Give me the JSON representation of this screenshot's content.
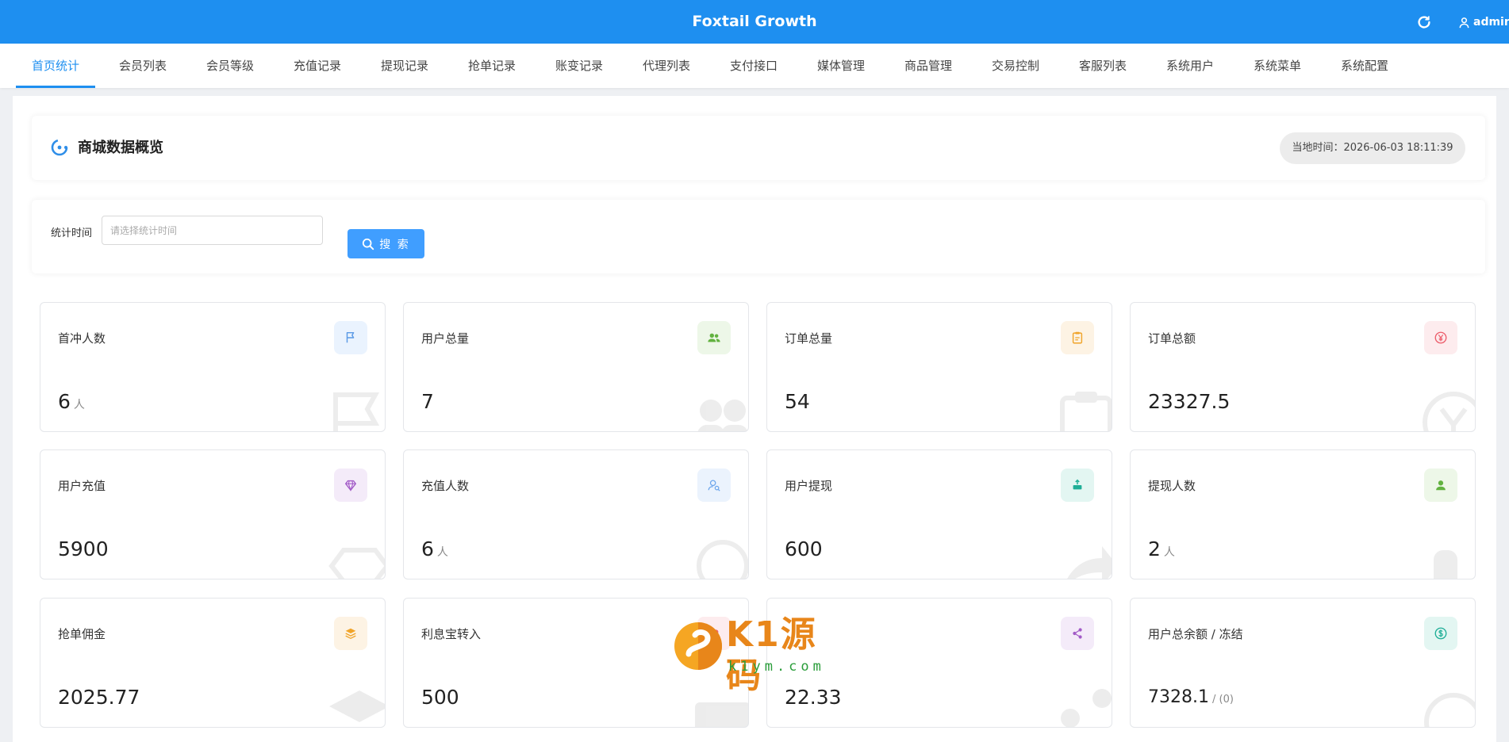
{
  "header": {
    "title": "Foxtail Growth",
    "user": "admin"
  },
  "nav": {
    "items": [
      {
        "label": "首页统计",
        "active": true
      },
      {
        "label": "会员列表"
      },
      {
        "label": "会员等级"
      },
      {
        "label": "充值记录"
      },
      {
        "label": "提现记录"
      },
      {
        "label": "抢单记录"
      },
      {
        "label": "账变记录"
      },
      {
        "label": "代理列表"
      },
      {
        "label": "支付接口"
      },
      {
        "label": "媒体管理"
      },
      {
        "label": "商品管理"
      },
      {
        "label": "交易控制"
      },
      {
        "label": "客服列表"
      },
      {
        "label": "系统用户"
      },
      {
        "label": "系统菜单"
      },
      {
        "label": "系统配置"
      }
    ]
  },
  "overview": {
    "title": "商城数据概览",
    "time_label": "当地时间：",
    "time_value": "2026-06-03 18:11:39"
  },
  "filter": {
    "label": "统计时间",
    "placeholder": "请选择统计时间",
    "search_label": "搜 索"
  },
  "cards": [
    {
      "label": "首冲人数",
      "value": "6",
      "unit": "人",
      "icon": "flag-icon",
      "color": "#5b9ae6",
      "bg": "#eaf3fe"
    },
    {
      "label": "用户总量",
      "value": "7",
      "icon": "users-icon",
      "color": "#62b240",
      "bg": "#edf7e8"
    },
    {
      "label": "订单总量",
      "value": "54",
      "icon": "clipboard-icon",
      "color": "#f0a42a",
      "bg": "#fdf3e4"
    },
    {
      "label": "订单总额",
      "value": "23327.5",
      "icon": "yen-icon",
      "color": "#ec5d6b",
      "bg": "#fdecee"
    },
    {
      "label": "用户充值",
      "value": "5900",
      "icon": "diamond-icon",
      "color": "#a25bc7",
      "bg": "#f4ebf9"
    },
    {
      "label": "充值人数",
      "value": "6",
      "unit": "人",
      "icon": "user-search-icon",
      "color": "#6ba5ec",
      "bg": "#ebf3fd"
    },
    {
      "label": "用户提现",
      "value": "600",
      "icon": "withdraw-icon",
      "color": "#1fae97",
      "bg": "#e3f6f2"
    },
    {
      "label": "提现人数",
      "value": "2",
      "unit": "人",
      "icon": "person-icon",
      "color": "#62b240",
      "bg": "#edf7e8"
    },
    {
      "label": "抢单佣金",
      "value": "2025.77",
      "icon": "stack-icon",
      "color": "#f0a42a",
      "bg": "#fdf3e4"
    },
    {
      "label": "利息宝转入",
      "value": "500",
      "icon": "heart-icon",
      "color": "#ec5d6b",
      "bg": "#fdecee"
    },
    {
      "label": "",
      "value": "22.33",
      "icon": "share-icon",
      "color": "#a25bc7",
      "bg": "#f4ebf9"
    },
    {
      "label": "用户总余额 / 冻结",
      "value": "7328.1",
      "sub": "/ (0)",
      "icon": "dollar-icon",
      "color": "#1fae97",
      "bg": "#e3f6f2"
    }
  ],
  "watermark": {
    "brand": "K1源码",
    "url": "k1ym.com"
  }
}
